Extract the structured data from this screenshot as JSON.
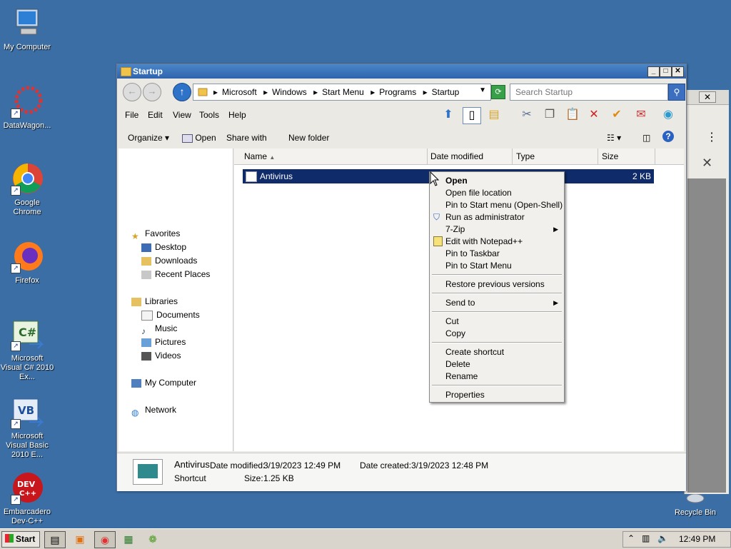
{
  "desktop": {
    "icons": [
      {
        "label": "My Computer"
      },
      {
        "label": "DataWagon..."
      },
      {
        "label": "Google Chrome"
      },
      {
        "label": "Firefox"
      },
      {
        "label": "Microsoft Visual C# 2010 Ex..."
      },
      {
        "label": "Microsoft Visual Basic 2010 E..."
      },
      {
        "label": "Embarcadero Dev-C++"
      },
      {
        "label": "Recycle Bin"
      }
    ]
  },
  "window": {
    "title": "Startup",
    "breadcrumbs": [
      "Microsoft",
      "Windows",
      "Start Menu",
      "Programs",
      "Startup"
    ],
    "search_placeholder": "Search Startup",
    "menu": [
      "File",
      "Edit",
      "View",
      "Tools",
      "Help"
    ],
    "commands": {
      "organize": "Organize",
      "open": "Open",
      "share": "Share with",
      "new_folder": "New folder"
    },
    "nav": {
      "favorites": "Favorites",
      "desktop": "Desktop",
      "downloads": "Downloads",
      "recent": "Recent Places",
      "libraries": "Libraries",
      "documents": "Documents",
      "music": "Music",
      "pictures": "Pictures",
      "videos": "Videos",
      "computer": "My Computer",
      "network": "Network"
    },
    "columns": {
      "name": "Name",
      "date": "Date modified",
      "type": "Type",
      "size": "Size"
    },
    "file": {
      "name": "Antivirus",
      "size": "2 KB"
    },
    "details": {
      "name": "Antivirus",
      "modified_label": "Date modified:",
      "modified": "3/19/2023 12:49 PM",
      "created_label": "Date created:",
      "created": "3/19/2023 12:48 PM",
      "type": "Shortcut",
      "size_label": "Size:",
      "size": "1.25 KB"
    }
  },
  "context_menu": {
    "open": "Open",
    "open_location": "Open file location",
    "pin_start_shell": "Pin to Start menu (Open-Shell)",
    "run_admin": "Run as administrator",
    "zip": "7-Zip",
    "notepad": "Edit with Notepad++",
    "pin_taskbar": "Pin to Taskbar",
    "pin_start": "Pin to Start Menu",
    "restore": "Restore previous versions",
    "send_to": "Send to",
    "cut": "Cut",
    "copy": "Copy",
    "create_shortcut": "Create shortcut",
    "delete": "Delete",
    "rename": "Rename",
    "properties": "Properties"
  },
  "taskbar": {
    "start": "Start",
    "time": "12:49 PM"
  },
  "colors": {
    "desktop": "#3a6ea5",
    "selection": "#102b6a",
    "titlebar": "#2f64ad"
  }
}
